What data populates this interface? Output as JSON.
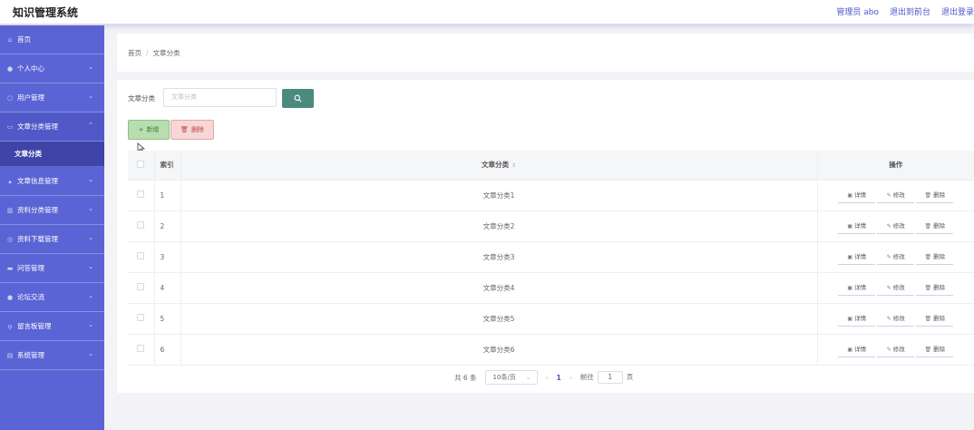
{
  "header": {
    "title": "知识管理系统",
    "links": [
      "管理员 abo",
      "退出到前台",
      "退出登录"
    ]
  },
  "sidebar": {
    "items": [
      {
        "label": "首页",
        "icon": "home-icon",
        "has_children": false
      },
      {
        "label": "个人中心",
        "icon": "user-icon",
        "has_children": true
      },
      {
        "label": "用户管理",
        "icon": "users-icon",
        "has_children": true
      },
      {
        "label": "文章分类管理",
        "icon": "article-icon",
        "has_children": true,
        "open": true
      },
      {
        "label": "文章信息管理",
        "icon": "thumb-icon",
        "has_children": true
      },
      {
        "label": "资料分类管理",
        "icon": "bank-icon",
        "has_children": true
      },
      {
        "label": "资料下载管理",
        "icon": "download-icon",
        "has_children": true
      },
      {
        "label": "问答管理",
        "icon": "chat-icon",
        "has_children": true
      },
      {
        "label": "论坛交流",
        "icon": "forum-icon",
        "has_children": true
      },
      {
        "label": "留言板管理",
        "icon": "mic-icon",
        "has_children": true
      },
      {
        "label": "系统管理",
        "icon": "settings-icon",
        "has_children": true
      }
    ],
    "active_sub": "文章分类"
  },
  "breadcrumb": {
    "home": "首页",
    "separator": "/",
    "current": "文章分类"
  },
  "search": {
    "label": "文章分类",
    "placeholder": "文章分类"
  },
  "toolbar": {
    "add_label": "新增",
    "delete_label": "删除"
  },
  "table": {
    "headers": {
      "index": "索引",
      "name": "文章分类",
      "ops": "操作"
    },
    "rows": [
      {
        "index": "1",
        "name": "文章分类1"
      },
      {
        "index": "2",
        "name": "文章分类2"
      },
      {
        "index": "3",
        "name": "文章分类3"
      },
      {
        "index": "4",
        "name": "文章分类4"
      },
      {
        "index": "5",
        "name": "文章分类5"
      },
      {
        "index": "6",
        "name": "文章分类6"
      }
    ],
    "row_actions": {
      "detail": "详情",
      "edit": "修改",
      "delete": "删除"
    }
  },
  "pagination": {
    "total": "共 6 条",
    "page_size": "10条/页",
    "current_page": "1",
    "goto_label": "前往",
    "goto_value": "1",
    "page_suffix": "页"
  },
  "colors": {
    "sidebar_bg": "#5b64d4",
    "sidebar_active": "#3e44a8",
    "accent": "#4a57c9",
    "search_btn": "#4a8b7e",
    "add_btn": "#b9ddb0",
    "delete_btn": "#f7d6d6"
  }
}
